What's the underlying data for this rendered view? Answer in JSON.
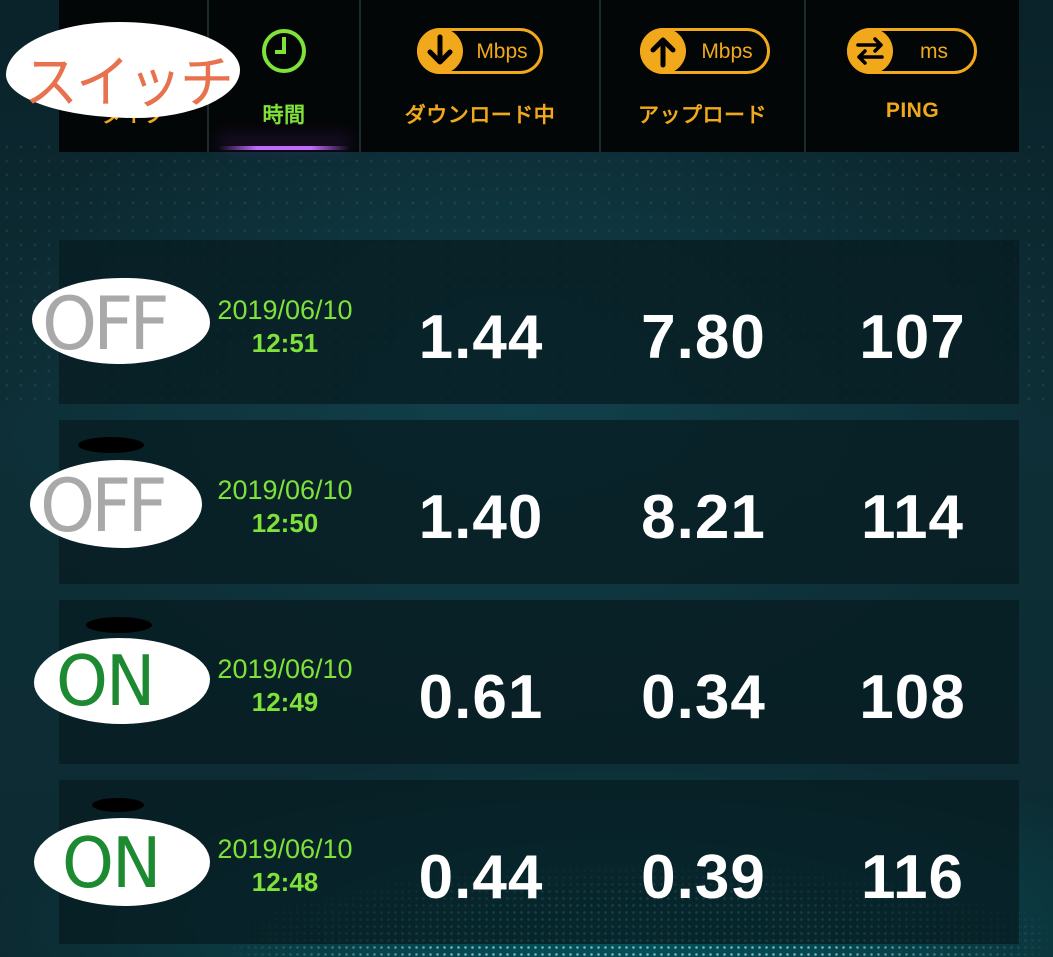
{
  "header": {
    "type_label": "タイプ",
    "time_label": "時間",
    "download_label": "ダウンロード中",
    "upload_label": "アップロード",
    "ping_label": "PING",
    "download_unit": "Mbps",
    "upload_unit": "Mbps",
    "ping_unit": "ms"
  },
  "annotation": {
    "switch_note": "スイッチ"
  },
  "rows": [
    {
      "switch": "OFF",
      "date": "2019/06/10",
      "time": "12:51",
      "download": "1.44",
      "upload": "7.80",
      "ping": "107"
    },
    {
      "switch": "OFF",
      "date": "2019/06/10",
      "time": "12:50",
      "download": "1.40",
      "upload": "8.21",
      "ping": "114"
    },
    {
      "switch": "ON",
      "date": "2019/06/10",
      "time": "12:49",
      "download": "0.61",
      "upload": "0.34",
      "ping": "108"
    },
    {
      "switch": "ON",
      "date": "2019/06/10",
      "time": "12:48",
      "download": "0.44",
      "upload": "0.39",
      "ping": "116"
    }
  ],
  "colors": {
    "accent_orange": "#f2a81b",
    "time_green": "#7fe23a",
    "value_white": "#ffffff",
    "annotation_red": "#e8714e",
    "annotation_gray": "#a9a9a9",
    "annotation_green": "#1d8a32"
  },
  "icons": {
    "time": "clock-icon",
    "download": "arrow-down-icon",
    "upload": "arrow-up-icon",
    "ping": "swap-arrows-icon"
  }
}
